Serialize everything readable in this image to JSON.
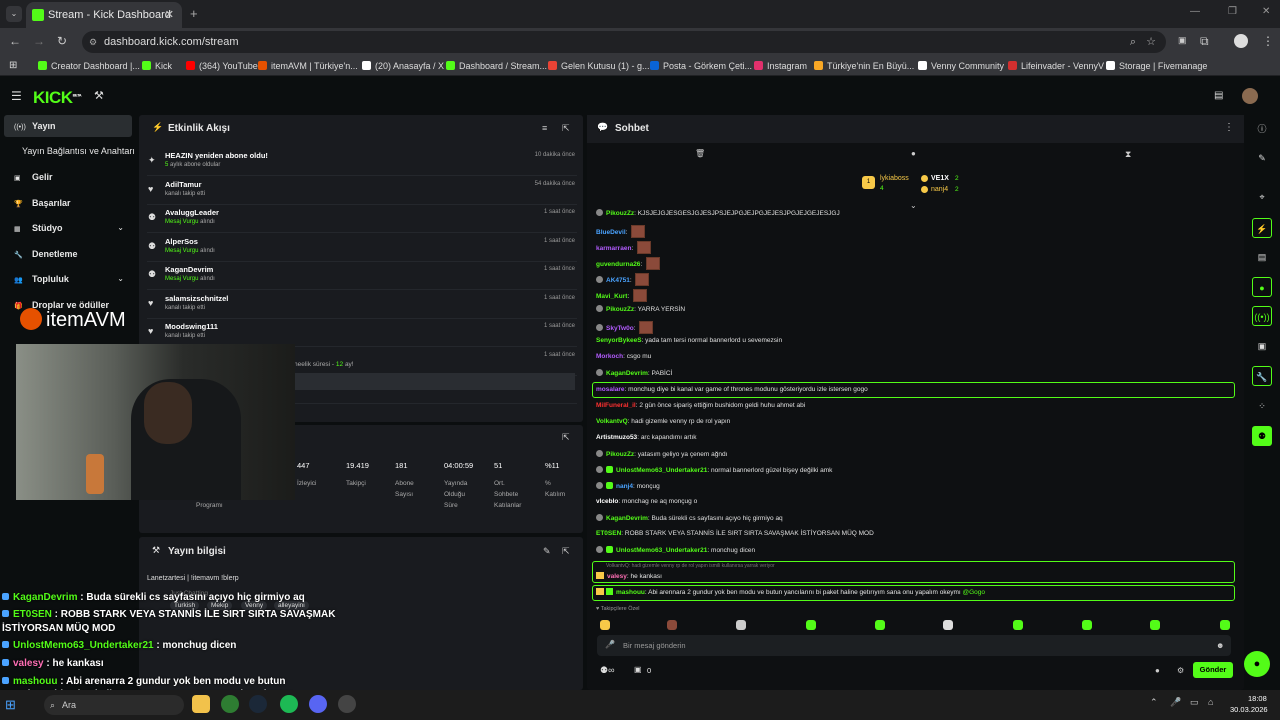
{
  "browser": {
    "tab_title": "Stream - Kick Dashboard",
    "url": "dashboard.kick.com/stream",
    "bookmarks": [
      {
        "label": "Creator Dashboard |...",
        "color": "#53fc18"
      },
      {
        "label": "Kick",
        "color": "#53fc18"
      },
      {
        "label": "(364) YouTube",
        "color": "#ff0000"
      },
      {
        "label": "itemAVM | Türkiye'n...",
        "color": "#e65100"
      },
      {
        "label": "(20) Anasayfa / X",
        "color": "#ffffff"
      },
      {
        "label": "Dashboard / Stream...",
        "color": "#53fc18"
      },
      {
        "label": "Gelen Kutusu (1) - g...",
        "color": "#ea4335"
      },
      {
        "label": "Posta - Görkem Çeti...",
        "color": "#0a64d6"
      },
      {
        "label": "Instagram",
        "color": "#e1306c"
      },
      {
        "label": "Türkiye'nin En Büyü...",
        "color": "#f9a825"
      },
      {
        "label": "Venny Community",
        "color": "#ffffff"
      },
      {
        "label": "Lifeinvader - VennyV",
        "color": "#d32f2f"
      },
      {
        "label": "Storage | Fivemanage",
        "color": "#ffffff"
      }
    ]
  },
  "header": {
    "logo": "KICK",
    "logo_sup": "BETA"
  },
  "sidebar": [
    {
      "label": "Yayın",
      "active": true
    },
    {
      "label": "Yayın Bağlantısı ve Anahtarı"
    },
    {
      "label": "Gelir"
    },
    {
      "label": "Başarılar"
    },
    {
      "label": "Stüdyo"
    },
    {
      "label": "Denetleme"
    },
    {
      "label": "Topluluk"
    },
    {
      "label": "Droplar ve ödüller"
    }
  ],
  "activity": {
    "title": "Etkinlik Akışı",
    "items": [
      {
        "name": "HEAZIN yeniden abone oldu!",
        "sub_num": "5",
        "sub": " aylık abone oldular",
        "time": "10 dakika önce"
      },
      {
        "name": "AdilTamur",
        "sub_num": "",
        "sub": "kanalı takip etti",
        "time": "54 dakika önce"
      },
      {
        "name": "AvaluggLeader",
        "sub_num": "Mesaj Vurgu",
        "sub": " alındı",
        "time": "1 saat önce"
      },
      {
        "name": "AlperSos",
        "sub_num": "Mesaj Vurgu",
        "sub": " alındı",
        "time": "1 saat önce"
      },
      {
        "name": "KaganDevrim",
        "sub_num": "Mesaj Vurgu",
        "sub": " alındı",
        "time": "1 saat önce"
      },
      {
        "name": "salamsizschnitzel",
        "sub_num": "",
        "sub": "kanalı takip etti",
        "time": "1 saat önce"
      },
      {
        "name": "Moodswing111",
        "sub_num": "",
        "sub": "kanalı takip etti",
        "time": "1 saat önce"
      },
      {
        "name": "",
        "sub_num": "",
        "sub": "",
        "time": "1 saat önce"
      },
      {
        "name": "",
        "sub_num": "",
        "sub": "",
        "time": "1 saat önce"
      }
    ],
    "partial_text": "neelik süresi - ",
    "partial_num": "12",
    "partial_suffix": " ay!"
  },
  "stats": {
    "values": [
      "447",
      "19.419",
      "181",
      "04:00:59",
      "51",
      "%11"
    ],
    "labels": [
      "İzleyici",
      "Takipçi",
      "Abone\nSayısı",
      "Yayında\nOlduğu\nSüre",
      "Ort.\nSohbete\nKatılanlar",
      "%\nKatılım"
    ],
    "extra_label": "Programı"
  },
  "stream_info": {
    "title": "Yayın bilgisi",
    "stream_title": "Lanetzartesi | !itemavm !blerp",
    "category": "Just Chatting",
    "tags": [
      "Turkish",
      "Mekip",
      "Venny",
      "alleyayini"
    ]
  },
  "chat": {
    "title": "Sohbet",
    "pinned": [
      {
        "user": "lykiaboss",
        "count": "4"
      },
      {
        "user": "VE1X",
        "count": "2"
      },
      {
        "user": "nanj4",
        "count": "2"
      }
    ],
    "messages": [
      {
        "user": "PikouzZz",
        "color": "#53fc18",
        "text": "KJSJEJGJESGESJGJESJPSJEJPGJEJPGJEJESJPGJEJGEJESJGJ",
        "badge": "g"
      },
      {
        "user": "BlueDevil",
        "color": "#4aa3ff",
        "text": "",
        "emote": true
      },
      {
        "user": "karmarraen",
        "color": "#b35cff",
        "text": "",
        "emote": true
      },
      {
        "user": "guvendurna26",
        "color": "#53fc18",
        "text": "",
        "emote": true
      },
      {
        "user": "AK4751",
        "color": "#4aa3ff",
        "text": "",
        "emote": true,
        "badge": "g"
      },
      {
        "user": "Mavi_Kurt",
        "color": "#53fc18",
        "text": "",
        "emote": true
      },
      {
        "user": "PikouzZz",
        "color": "#53fc18",
        "text": "YARRA YERSİN",
        "badge": "g"
      },
      {
        "user": "SkyTw0o",
        "color": "#b35cff",
        "text": "",
        "emote": true,
        "badge": "g"
      },
      {
        "user": "SenyorBykeeS",
        "color": "#53fc18",
        "text": "yada tam tersi normal bannerlord u sevemezsin"
      },
      {
        "user": "Morkoch",
        "color": "#b35cff",
        "text": "csgo mu"
      },
      {
        "user": "KaganDevrim",
        "color": "#53fc18",
        "text": "PABİCİ",
        "badge": "g"
      },
      {
        "user": "mosalare",
        "color": "#b35cff",
        "text": "monchug diye bi kanal var game of thrones modunu gösteriyordu izle istersen gogo",
        "highlight": true
      },
      {
        "user": "MilFuneral_il",
        "color": "#ff3030",
        "text": "2 gün önce sipariş ettiğim bushidom geldi huhu ahmet abi"
      },
      {
        "user": "VolkantvQ",
        "color": "#53fc18",
        "text": "hadi gizemle venny rp de rol yapın"
      },
      {
        "user": "Artistmuzo53",
        "color": "#ffffff",
        "text": "arc kapandımı artık"
      },
      {
        "user": "PikouzZz",
        "color": "#53fc18",
        "text": "yatasım geliyo ya çenem ağndı",
        "badge": "g"
      },
      {
        "user": "UnlostMemo63_Undertaker21",
        "color": "#53fc18",
        "text": "normal bannerlord güzel bişey değilki amk",
        "badge": "gg"
      },
      {
        "user": "nanj4",
        "color": "#4aa3ff",
        "text": "monçug",
        "badge": "gg"
      },
      {
        "user": "vlceblo",
        "color": "#ffffff",
        "text": "monchag ne aq monçug o"
      },
      {
        "user": "KaganDevrim",
        "color": "#53fc18",
        "text": "Buda sürekli cs sayfasını açıyo hiç girmiyo aq",
        "badge": "g"
      },
      {
        "user": "ET0SEN",
        "color": "#53fc18",
        "text": "ROBB STARK VEYA STANNİS İLE SIRT SIRTA SAVAŞMAK İSTİYORSAN MÜQ MOD"
      },
      {
        "user": "UnlostMemo63_Undertaker21",
        "color": "#53fc18",
        "text": "monchug dicen",
        "badge": "gg"
      }
    ],
    "reply_ref": "VolkantvQ: hadi gizemle venny rp de rol yapın ismili kullanırsa yarrak veriyor",
    "reply_user": "valesy",
    "reply_text": "he kankası",
    "hl_user": "mashouu",
    "hl_text": "Abi arennara 2 gundur yok ben modu ve butun yancılarını bi paket haline getırıyım sana onu yapalım okeymı ",
    "hl_mention": "@Gogo",
    "followers_label": "Takipçilere Özel",
    "input_placeholder": "Bir mesaj gönderin",
    "footer_count": "0",
    "send_label": "Gönder"
  },
  "overlay": {
    "brand": "itemAVM",
    "lines": [
      {
        "user": "KaganDevrim",
        "color": "#53fc18",
        "text": " : Buda sürekli cs sayfasını açıyo hiç girmiyo aq"
      },
      {
        "user": "ET0SEN",
        "color": "#53fc18",
        "text": " : ROBB STARK VEYA STANNİS İLE SIRT SIRTA SAVAŞMAK"
      },
      {
        "user": "",
        "color": "#ffffff",
        "text": "İSTİYORSAN MÜQ MOD"
      },
      {
        "user": "UnlostMemo63_Undertaker21",
        "color": "#53fc18",
        "text": " : monchug dicen"
      },
      {
        "user": "valesy",
        "color": "#ff6fb5",
        "text": " : he kankası"
      },
      {
        "user": "mashouu",
        "color": "#53fc18",
        "text": " : Abi arenarra 2 gundur yok ben modu ve butun"
      },
      {
        "user": "",
        "color": "#ffffff",
        "text": "yancılarını bi paket haline getırıyım sana onu yapalım okeymı"
      },
      {
        "user": "",
        "color": "#4aa3ff",
        "text": "@Gogo"
      }
    ]
  },
  "taskbar": {
    "search": "Ara",
    "time": "18:08",
    "date": "30.03.2026"
  }
}
